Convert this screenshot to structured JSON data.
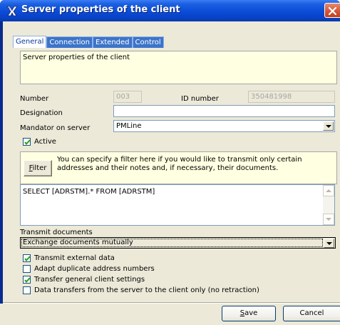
{
  "window": {
    "title": "Server properties of the client"
  },
  "tabs": [
    {
      "label": "General"
    },
    {
      "label": "Connection"
    },
    {
      "label": "Extended"
    },
    {
      "label": "Control"
    }
  ],
  "general": {
    "description": "Server properties of the client",
    "number_label": "Number",
    "number_value": "003",
    "id_number_label": "ID number",
    "id_number_value": "350481998",
    "designation_label": "Designation",
    "designation_value": "",
    "mandator_label": "Mandator on server",
    "mandator_value": "PMLine",
    "active_label": "Active",
    "active_checked": true
  },
  "filter": {
    "button_label_u": "F",
    "button_label_rest": "ilter",
    "hint_line1": "You can specify a filter here if you would like to transmit only certain",
    "hint_line2": "addresses and their notes and, if necessary, their documents.",
    "sql": "SELECT [ADRSTM].* FROM [ADRSTM]"
  },
  "transmit": {
    "label": "Transmit documents",
    "value": "Exchange documents mutually"
  },
  "options": [
    {
      "label": "Transmit external data",
      "checked": true
    },
    {
      "label": "Adapt duplicate address numbers",
      "checked": false
    },
    {
      "label": "Transfer general client settings",
      "checked": true
    },
    {
      "label": "Data transfers from the server to the client only (no retraction)",
      "checked": false
    }
  ],
  "buttons": {
    "save_u": "S",
    "save_rest": "ave",
    "cancel": "Cancel"
  },
  "colors": {
    "titlebar": "#0b4bd6",
    "info_background": "#ffffe1",
    "dialog_background": "#ece9d8"
  }
}
